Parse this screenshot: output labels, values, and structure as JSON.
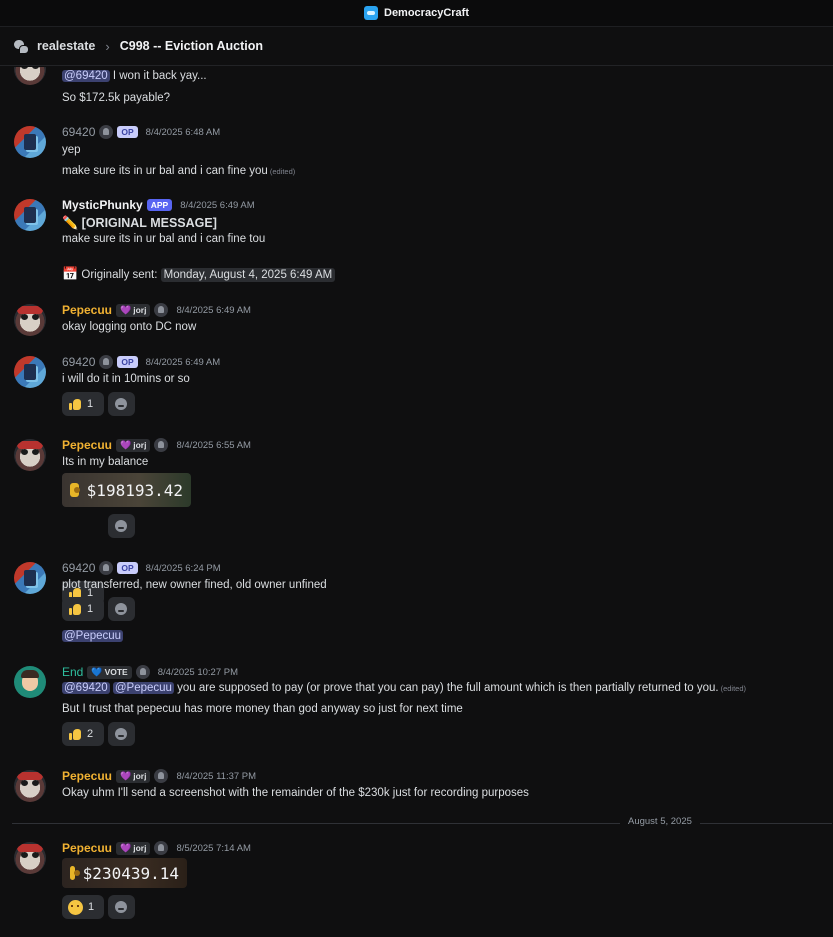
{
  "titlebar": {
    "app_name": "DemocracyCraft",
    "icon": "democracycraft-logo-icon"
  },
  "channel": {
    "forum": "realestate",
    "separator": "›",
    "thread": "C998 -- Eviction Auction"
  },
  "messages": {
    "m0": {
      "line1_mention": "@69420",
      "line1_text": "I won it back yay...",
      "line2": "So $172.5k payable?"
    },
    "m1": {
      "author": "69420",
      "badge": "OP",
      "time": "8/4/2025 6:48 AM",
      "line1": "yep",
      "line2": "make sure its in ur bal and i can fine you",
      "edited": "(edited)"
    },
    "m2": {
      "author": "MysticPhunky",
      "badge": "APP",
      "time": "8/4/2025 6:49 AM",
      "pencil": "✏️",
      "header_text": "[ORIGINAL MESSAGE]",
      "line1": "make sure its in ur bal and i can fine tou",
      "calendar": "📅",
      "sent_label": "Originally sent:",
      "sent_time": "Monday, August 4, 2025 6:49 AM"
    },
    "m3": {
      "author": "Pepecuu",
      "heart": "💜",
      "tag": "jorj",
      "time": "8/4/2025 6:49 AM",
      "line1": "okay logging onto DC now"
    },
    "m4": {
      "author": "69420",
      "badge": "OP",
      "time": "8/4/2025 6:49 AM",
      "line1": "i will do it in 10mins or so",
      "react_count": "1"
    },
    "m5": {
      "author": "Pepecuu",
      "heart": "💜",
      "tag": "jorj",
      "time": "8/4/2025 6:55 AM",
      "line1": "Its in my balance",
      "amount": "$198193.42",
      "react_count": "1"
    },
    "m6": {
      "author": "69420",
      "badge": "OP",
      "time": "8/4/2025 6:24 PM",
      "line1": "plot transferred, new owner fined, old owner unfined",
      "react_count": "1",
      "mention_line": "@Pepecuu"
    },
    "m7": {
      "author": "End",
      "heart": "💙",
      "tag": "VOTE",
      "time": "8/4/2025 10:27 PM",
      "mention1": "@69420",
      "mention2": "@Pepecuu",
      "line1": "you are supposed to pay (or prove that you can pay) the full amount which is then partially returned to you.",
      "edited": "(edited)",
      "line2": "But I trust that pepecuu has more money than god anyway so just for next time",
      "react_count": "2"
    },
    "m8": {
      "author": "Pepecuu",
      "heart": "💜",
      "tag": "jorj",
      "time": "8/4/2025 11:37 PM",
      "line1": "Okay uhm I'll send a screenshot with the remainder of the $230k just for recording purposes"
    },
    "divider": "August 5, 2025",
    "m9": {
      "author": "Pepecuu",
      "heart": "💜",
      "tag": "jorj",
      "time": "8/5/2025 7:14 AM",
      "amount": "$230439.14",
      "react_count": "1"
    }
  },
  "colors": {
    "background": "#0f0f10",
    "accent": "#5865f2",
    "mention_bg": "#3c4270",
    "pepecuu_name": "#f0b132",
    "end_name": "#2fbf9f"
  }
}
